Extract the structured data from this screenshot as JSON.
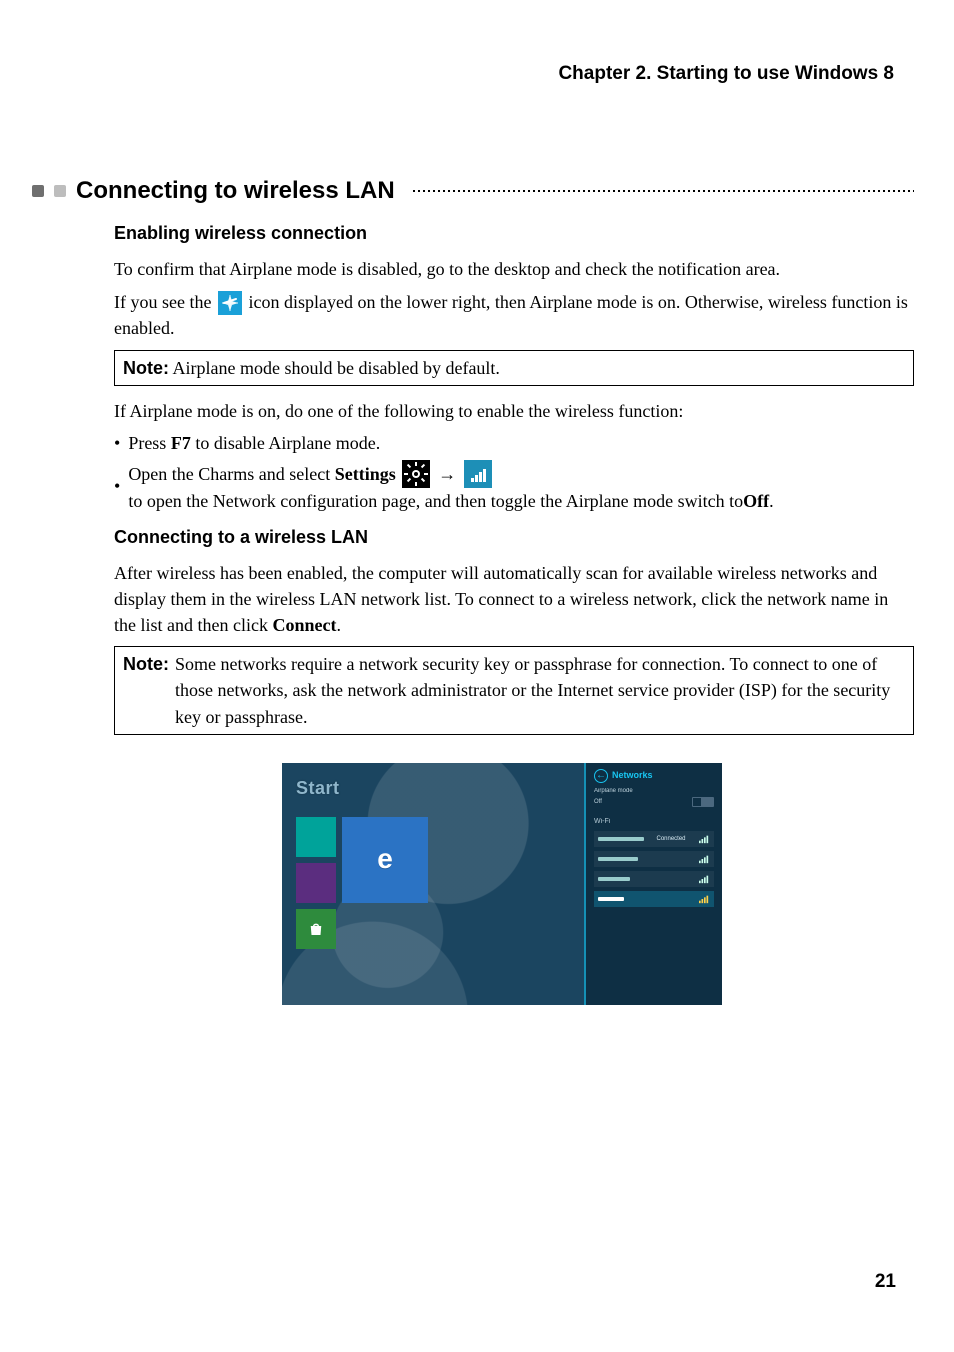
{
  "chapter_title": "Chapter 2. Starting to use Windows 8",
  "h1": "Connecting to wireless LAN",
  "s1": {
    "heading": "Enabling wireless connection",
    "p1": "To confirm that Airplane mode is disabled, go to the desktop and check the notification area.",
    "p2a": "If you see the ",
    "p2b": " icon displayed on the lower right, then Airplane mode is on. Otherwise, wireless function is enabled.",
    "note_label": "Note:",
    "note_text": "Airplane mode should be disabled by default.",
    "p3": "If Airplane mode is on, do one of the following to enable the wireless function:",
    "bullet1_a": "Press ",
    "bullet1_key": "F7",
    "bullet1_b": " to disable Airplane mode.",
    "bullet2_a": "Open the Charms and select ",
    "bullet2_settings": "Settings",
    "bullet2_arrow": "→",
    "bullet2_b": " to open the Network configuration page, and then toggle the Airplane mode switch to ",
    "bullet2_off": "Off",
    "bullet2_period": "."
  },
  "s2": {
    "heading": "Connecting to a wireless LAN",
    "p1": "After wireless has been enabled, the computer will automatically scan for available wireless networks and display them in the wireless LAN network list. To connect to a wireless network, click the network name in the list and then click ",
    "connect_label": "Connect",
    "p1_end": ".",
    "note_label": "Note:",
    "note_text": "Some networks require a network security key or passphrase for connection. To connect to one of those networks, ask the network administrator or the Internet service provider (ISP) for the security key or passphrase."
  },
  "screenshot": {
    "start_label": "Start",
    "networks_title": "Networks",
    "airplane_label": "Airplane mode",
    "airplane_state": "Off",
    "wifi_header": "Wi-Fi",
    "item_connected": "Connected"
  },
  "page_number": "21",
  "icon_names": {
    "airplane": "airplane-icon",
    "gear": "settings-gear-icon",
    "signal": "wifi-signal-icon"
  }
}
